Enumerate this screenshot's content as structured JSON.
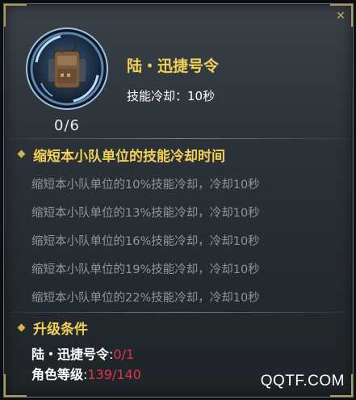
{
  "skill": {
    "name": "陆・迅捷号令",
    "cooldown_label": "技能冷却：10秒",
    "level_display": "0/6"
  },
  "effect": {
    "title": "缩短本小队单位的技能冷却时间",
    "rows": [
      "缩短本小队单位的10%技能冷却，冷却10秒",
      "缩短本小队单位的13%技能冷却，冷却10秒",
      "缩短本小队单位的16%技能冷却，冷却10秒",
      "缩短本小队单位的19%技能冷却，冷却10秒",
      "缩短本小队单位的22%技能冷却，冷却10秒"
    ]
  },
  "upgrade": {
    "title": "升级条件",
    "req1_label": "陆・迅捷号令",
    "req1_sep": ":",
    "req1_current": "0",
    "req1_total": "/1",
    "req2_label": "角色等级",
    "req2_sep": ":",
    "req2_current": "139",
    "req2_total": "/140"
  },
  "watermark": "QQTF.COM",
  "colors": {
    "gold": "#f2cf55",
    "dim_text": "#8d969d",
    "unmet_red": "#e0324a",
    "accent_diamond": "#d6b24f"
  },
  "icons": [
    "close-icon",
    "skill-portrait-icon",
    "diamond-bullet-icon"
  ]
}
